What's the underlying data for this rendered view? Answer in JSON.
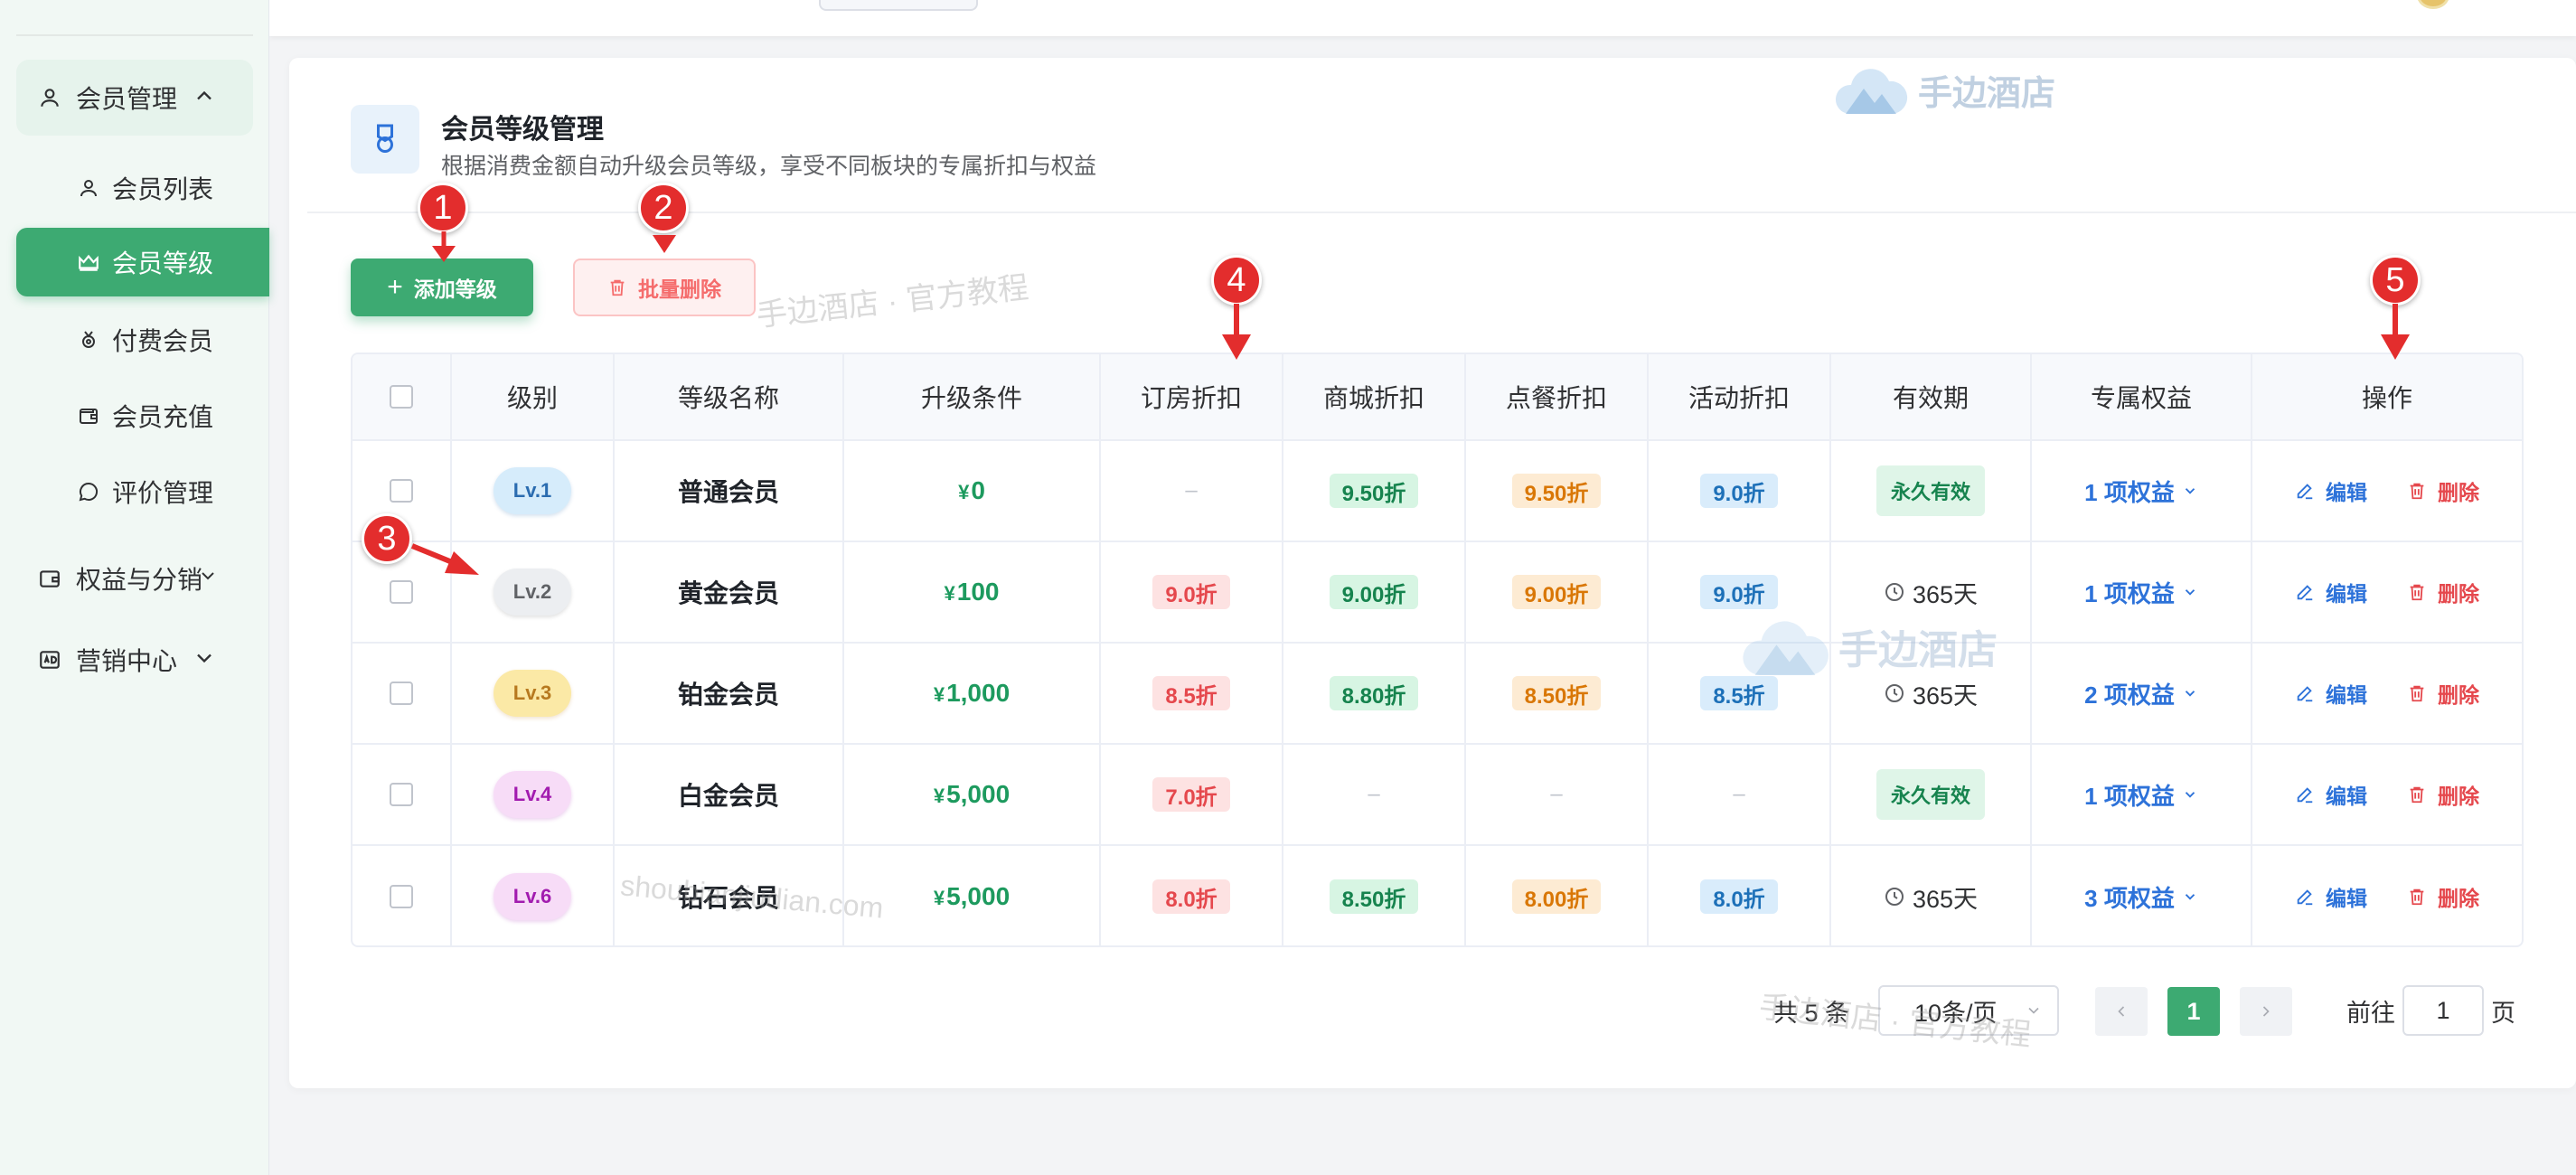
{
  "sidebar": {
    "groups": [
      {
        "label": "会员管理",
        "icon": "user-icon",
        "open": true
      },
      {
        "label": "权益与分销",
        "icon": "wallet-icon",
        "open": false
      },
      {
        "label": "营销中心",
        "icon": "ad-icon",
        "open": false
      }
    ],
    "items": [
      {
        "label": "会员列表",
        "icon": "user-icon"
      },
      {
        "label": "会员等级",
        "icon": "crown-icon",
        "active": true
      },
      {
        "label": "付费会员",
        "icon": "medal-icon"
      },
      {
        "label": "会员充值",
        "icon": "wallet-icon"
      },
      {
        "label": "评价管理",
        "icon": "comment-icon"
      }
    ]
  },
  "header": {
    "title": "会员等级管理",
    "subtitle": "根据消费金额自动升级会员等级，享受不同板块的专属折扣与权益"
  },
  "toolbar": {
    "add_label": "添加等级",
    "batch_delete_label": "批量删除"
  },
  "table": {
    "columns": [
      "级别",
      "等级名称",
      "升级条件",
      "订房折扣",
      "商城折扣",
      "点餐折扣",
      "活动折扣",
      "有效期",
      "专属权益",
      "操作"
    ],
    "rows": [
      {
        "level": "Lv.1",
        "level_color": "blue",
        "name": "普通会员",
        "currency": "¥",
        "condition": "0",
        "room": "–",
        "mall": "9.50折",
        "dining": "9.50折",
        "activity": "9.0折",
        "validity": "永久有效",
        "validity_permanent": true,
        "rights": "1 项权益",
        "edit": "编辑",
        "delete": "删除"
      },
      {
        "level": "Lv.2",
        "level_color": "gray",
        "name": "黄金会员",
        "currency": "¥",
        "condition": "100",
        "room": "9.0折",
        "mall": "9.00折",
        "dining": "9.00折",
        "activity": "9.0折",
        "validity": "365天",
        "validity_permanent": false,
        "rights": "1 项权益",
        "edit": "编辑",
        "delete": "删除"
      },
      {
        "level": "Lv.3",
        "level_color": "yellow",
        "name": "铂金会员",
        "currency": "¥",
        "condition": "1,000",
        "room": "8.5折",
        "mall": "8.80折",
        "dining": "8.50折",
        "activity": "8.5折",
        "validity": "365天",
        "validity_permanent": false,
        "rights": "2 项权益",
        "edit": "编辑",
        "delete": "删除"
      },
      {
        "level": "Lv.4",
        "level_color": "pink",
        "name": "白金会员",
        "currency": "¥",
        "condition": "5,000",
        "room": "7.0折",
        "mall": "–",
        "dining": "–",
        "activity": "–",
        "validity": "永久有效",
        "validity_permanent": true,
        "rights": "1 项权益",
        "edit": "编辑",
        "delete": "删除"
      },
      {
        "level": "Lv.6",
        "level_color": "pink",
        "name": "钻石会员",
        "currency": "¥",
        "condition": "5,000",
        "room": "8.0折",
        "mall": "8.50折",
        "dining": "8.00折",
        "activity": "8.0折",
        "validity": "365天",
        "validity_permanent": false,
        "rights": "3 项权益",
        "edit": "编辑",
        "delete": "删除"
      }
    ]
  },
  "pagination": {
    "total": "共 5 条",
    "page_size": "10条/页",
    "current_page": "1",
    "goto_label": "前往",
    "goto_value": "1",
    "page_unit": "页"
  },
  "callouts": [
    "1",
    "2",
    "3",
    "4",
    "5"
  ],
  "watermarks": {
    "brand": "手边酒店",
    "tutorial": "手边酒店 · 官方教程",
    "site": "shoubianjiudian.com"
  },
  "colors": {
    "accent": "#3daa72",
    "danger": "#e5484d",
    "link": "#2d72d9",
    "callout": "#e32d2d"
  }
}
